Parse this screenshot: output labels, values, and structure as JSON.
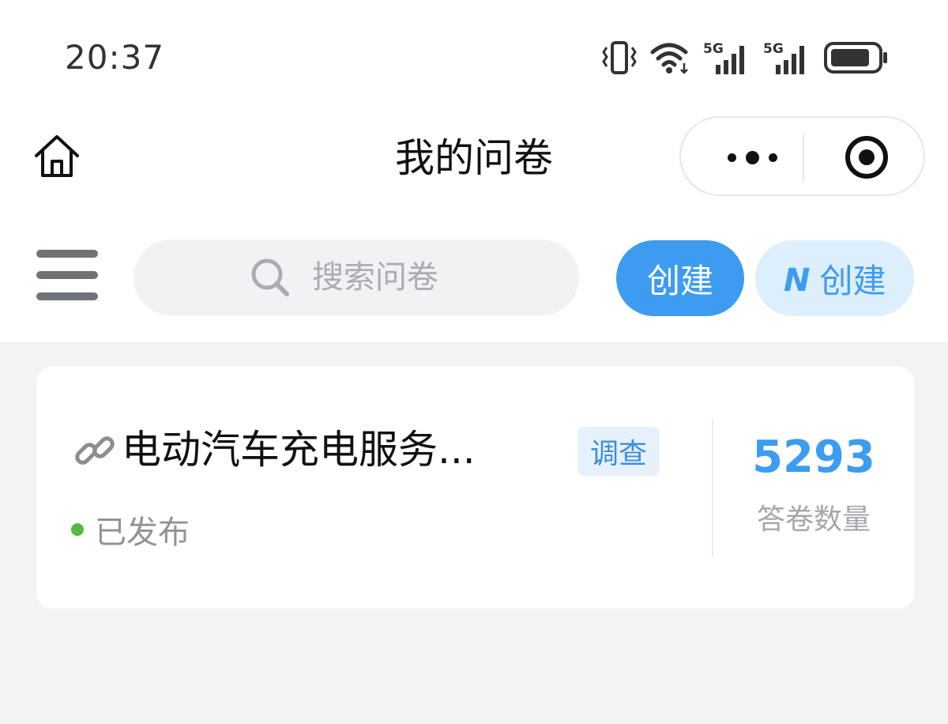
{
  "status_bar": {
    "time": "20:37",
    "icons": [
      "vibrate-icon",
      "wifi-icon",
      "signal-5g-icon",
      "signal-5g-icon",
      "battery-icon"
    ],
    "network_labels": [
      "5G",
      "5G"
    ]
  },
  "nav": {
    "title": "我的问卷",
    "icons": [
      "home-icon",
      "more-icon",
      "close-target-icon"
    ]
  },
  "toolbar": {
    "search_placeholder": "搜索问卷",
    "create_label": "创建",
    "ai_create_label": "创建",
    "ai_logo_letter": "N",
    "icons": [
      "menu-icon",
      "search-icon",
      "ai-logo-icon"
    ]
  },
  "surveys": [
    {
      "title": "电动汽车充电服务...",
      "type": "调查",
      "status": "已发布",
      "count": "5293",
      "count_label": "答卷数量",
      "icon": "link-icon"
    }
  ],
  "colors": {
    "accent": "#3d9cf0",
    "accent_light": "#ddeefc",
    "published_dot": "#5bb83f",
    "page_background": "#f2f3f5"
  }
}
